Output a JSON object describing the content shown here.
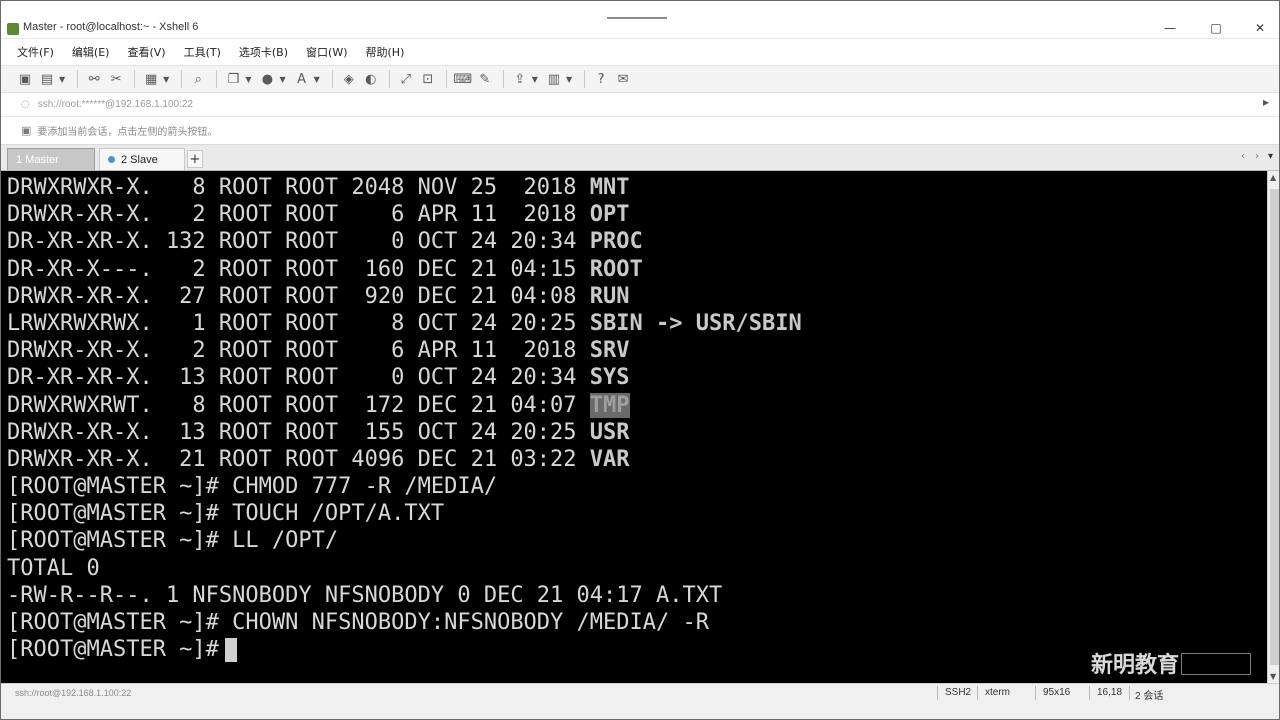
{
  "window": {
    "title": "Master - root@localhost:~ - Xshell 6",
    "controls": {
      "minimize": "—",
      "maximize": "□",
      "close": "✕"
    }
  },
  "menu": [
    "文件(F)",
    "编辑(E)",
    "查看(V)",
    "工具(T)",
    "选项卡(B)",
    "窗口(W)",
    "帮助(H)"
  ],
  "address": {
    "text": "ssh://root:******@192.168.1.100:22",
    "arrow": "▸"
  },
  "hint": {
    "text": "要添加当前会话，点击左侧的箭头按钮。"
  },
  "tabs": [
    {
      "label": "1 Master",
      "active": true
    },
    {
      "label": "2 Slave",
      "active": false
    }
  ],
  "tab_add": "+",
  "terminal": {
    "lines": [
      {
        "pre": "DRWXRWXR-X.   8 ROOT ROOT 2048 NOV 25  2018 ",
        "name": "MNT"
      },
      {
        "pre": "DRWXR-XR-X.   2 ROOT ROOT    6 APR 11  2018 ",
        "name": "OPT"
      },
      {
        "pre": "DR-XR-XR-X. 132 ROOT ROOT    0 OCT 24 20:34 ",
        "name": "PROC"
      },
      {
        "pre": "DR-XR-X---.   2 ROOT ROOT  160 DEC 21 04:15 ",
        "name": "ROOT"
      },
      {
        "pre": "DRWXR-XR-X.  27 ROOT ROOT  920 DEC 21 04:08 ",
        "name": "RUN"
      },
      {
        "pre": "LRWXRWXRWX.   1 ROOT ROOT    8 OCT 24 20:25 ",
        "name": "SBIN -> USR/SBIN"
      },
      {
        "pre": "DRWXR-XR-X.   2 ROOT ROOT    6 APR 11  2018 ",
        "name": "SRV"
      },
      {
        "pre": "DR-XR-XR-X.  13 ROOT ROOT    0 OCT 24 20:34 ",
        "name": "SYS"
      },
      {
        "pre": "DRWXRWXRWT.   8 ROOT ROOT  172 DEC 21 04:07 ",
        "name": "TMP"
      },
      {
        "pre": "DRWXR-XR-X.  13 ROOT ROOT  155 OCT 24 20:25 ",
        "name": "USR"
      },
      {
        "pre": "DRWXR-XR-X.  21 ROOT ROOT 4096 DEC 21 03:22 ",
        "name": "VAR"
      },
      {
        "pre": "[ROOT@MASTER ~]# CHMOD 777 -R /MEDIA/",
        "name": ""
      },
      {
        "pre": "[ROOT@MASTER ~]# TOUCH /OPT/A.TXT",
        "name": ""
      },
      {
        "pre": "[ROOT@MASTER ~]# LL /OPT/",
        "name": ""
      },
      {
        "pre": "TOTAL 0",
        "name": ""
      },
      {
        "pre": "-RW-R--R--. 1 NFSNOBODY NFSNOBODY 0 DEC 21 04:17 A.TXT",
        "name": ""
      },
      {
        "pre": "[ROOT@MASTER ~]# CHOWN NFSNOBODY:NFSNOBODY /MEDIA/ -R",
        "name": ""
      },
      {
        "pre": "[ROOT@MASTER ~]#",
        "name": ""
      }
    ],
    "watermark": "新明教育"
  },
  "status": {
    "left": "ssh://root@192.168.1.100:22",
    "protocol": "SSH2",
    "term": "xterm",
    "size": "95x16",
    "cursor_pos": "16,18",
    "sessions": "2 会话"
  },
  "colors": {
    "terminal_bg": "#000000",
    "terminal_fg": "#d8d8d8",
    "tab_active": "#c7c7c7",
    "chrome": "#f0f0f0"
  }
}
